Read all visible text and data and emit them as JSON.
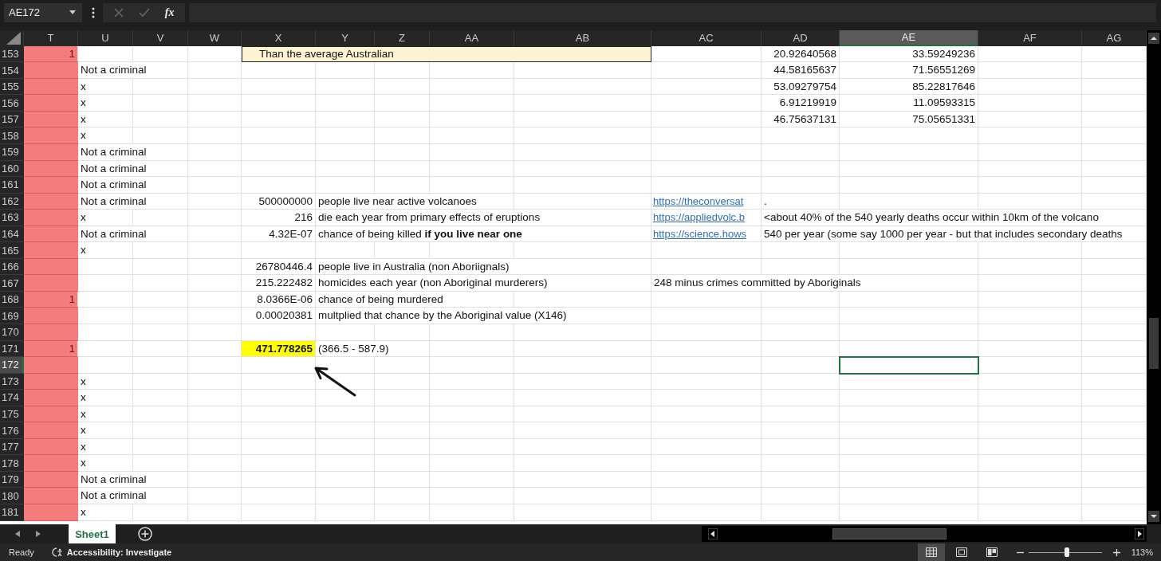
{
  "formula_bar": {
    "name_box": "AE172",
    "function_label": "fx",
    "edit_buttons_disabled": true
  },
  "columns": [
    {
      "label": "T",
      "selected": false
    },
    {
      "label": "U",
      "selected": false
    },
    {
      "label": "V",
      "selected": false
    },
    {
      "label": "W",
      "selected": false
    },
    {
      "label": "X",
      "selected": false
    },
    {
      "label": "Y",
      "selected": false
    },
    {
      "label": "Z",
      "selected": false
    },
    {
      "label": "AA",
      "selected": false
    },
    {
      "label": "AB",
      "selected": false
    },
    {
      "label": "AC",
      "selected": false
    },
    {
      "label": "AD",
      "selected": false
    },
    {
      "label": "AE",
      "selected": true
    },
    {
      "label": "AF",
      "selected": false
    },
    {
      "label": "AG",
      "selected": false
    }
  ],
  "rows": [
    {
      "label": "153",
      "selected": false,
      "flagged": true,
      "cells": [
        {
          "kind": "number",
          "text": "1"
        },
        null,
        null,
        null,
        {
          "kind": "note",
          "text": "Than the average Australian"
        },
        {
          "kind": "merged"
        },
        {
          "kind": "merged"
        },
        {
          "kind": "merged"
        },
        {
          "kind": "merged"
        },
        null,
        {
          "kind": "number",
          "text": "20.92640568"
        },
        {
          "kind": "number",
          "text": "33.59249236"
        },
        null,
        null
      ]
    },
    {
      "label": "154",
      "selected": false,
      "flagged": true,
      "cells": [
        null,
        {
          "kind": "text",
          "text": "Not a criminal"
        },
        null,
        null,
        null,
        null,
        null,
        null,
        null,
        null,
        {
          "kind": "number",
          "text": "44.58165637"
        },
        {
          "kind": "number",
          "text": "71.56551269"
        },
        null,
        null
      ]
    },
    {
      "label": "155",
      "selected": false,
      "flagged": true,
      "cells": [
        null,
        {
          "kind": "text",
          "text": "x"
        },
        null,
        null,
        null,
        null,
        null,
        null,
        null,
        null,
        {
          "kind": "number",
          "text": "53.09279754"
        },
        {
          "kind": "number",
          "text": "85.22817646"
        },
        null,
        null
      ]
    },
    {
      "label": "156",
      "selected": false,
      "flagged": true,
      "cells": [
        null,
        {
          "kind": "text",
          "text": "x"
        },
        null,
        null,
        null,
        null,
        null,
        null,
        null,
        null,
        {
          "kind": "number",
          "text": "6.91219919"
        },
        {
          "kind": "number",
          "text": "11.09593315"
        },
        null,
        null
      ]
    },
    {
      "label": "157",
      "selected": false,
      "flagged": true,
      "cells": [
        null,
        {
          "kind": "text",
          "text": "x"
        },
        null,
        null,
        null,
        null,
        null,
        null,
        null,
        null,
        {
          "kind": "number",
          "text": "46.75637131"
        },
        {
          "kind": "number",
          "text": "75.05651331"
        },
        null,
        null
      ]
    },
    {
      "label": "158",
      "selected": false,
      "flagged": true,
      "cells": [
        null,
        {
          "kind": "text",
          "text": "x"
        },
        null,
        null,
        null,
        null,
        null,
        null,
        null,
        null,
        null,
        null,
        null,
        null
      ]
    },
    {
      "label": "159",
      "selected": false,
      "flagged": true,
      "cells": [
        null,
        {
          "kind": "text",
          "text": "Not a criminal"
        },
        null,
        null,
        null,
        null,
        null,
        null,
        null,
        null,
        null,
        null,
        null,
        null
      ]
    },
    {
      "label": "160",
      "selected": false,
      "flagged": true,
      "cells": [
        null,
        {
          "kind": "text",
          "text": "Not a criminal"
        },
        null,
        null,
        null,
        null,
        null,
        null,
        null,
        null,
        null,
        null,
        null,
        null
      ]
    },
    {
      "label": "161",
      "selected": false,
      "flagged": true,
      "cells": [
        null,
        {
          "kind": "text",
          "text": "Not a criminal"
        },
        null,
        null,
        null,
        null,
        null,
        null,
        null,
        null,
        null,
        null,
        null,
        null
      ]
    },
    {
      "label": "162",
      "selected": false,
      "flagged": true,
      "cells": [
        null,
        {
          "kind": "text",
          "text": "Not a criminal"
        },
        null,
        null,
        {
          "kind": "number",
          "text": "500000000"
        },
        {
          "kind": "text",
          "text": "people live near active volcanoes"
        },
        null,
        null,
        null,
        {
          "kind": "link",
          "text": "https://theconversat"
        },
        {
          "kind": "text",
          "text": "."
        },
        null,
        null,
        null
      ]
    },
    {
      "label": "163",
      "selected": false,
      "flagged": true,
      "cells": [
        null,
        {
          "kind": "text",
          "text": "x"
        },
        null,
        null,
        {
          "kind": "number",
          "text": "216"
        },
        {
          "kind": "text",
          "text": "die each year from primary effects of eruptions"
        },
        null,
        null,
        null,
        {
          "kind": "link",
          "text": "https://appliedvolc.b"
        },
        {
          "kind": "text",
          "text": "<about 40% of the 540 yearly deaths occur within 10km of the volcano"
        },
        null,
        null,
        null
      ]
    },
    {
      "label": "164",
      "selected": false,
      "flagged": true,
      "cells": [
        null,
        {
          "kind": "text",
          "text": "Not a criminal"
        },
        null,
        null,
        {
          "kind": "number",
          "text": "4.32E-07"
        },
        {
          "kind": "text",
          "text": "chance of being killed **if you live near one**"
        },
        null,
        null,
        null,
        {
          "kind": "link",
          "text": "https://science.hows"
        },
        {
          "kind": "text",
          "text": "540 per year (some say 1000 per year - but that includes secondary deaths"
        },
        null,
        null,
        null
      ]
    },
    {
      "label": "165",
      "selected": false,
      "flagged": true,
      "cells": [
        null,
        {
          "kind": "text",
          "text": "x"
        },
        null,
        null,
        null,
        null,
        null,
        null,
        null,
        null,
        null,
        null,
        null,
        null
      ]
    },
    {
      "label": "166",
      "selected": false,
      "flagged": true,
      "cells": [
        null,
        null,
        null,
        null,
        {
          "kind": "number",
          "text": "26780446.4"
        },
        {
          "kind": "text",
          "text": "people live in Australia (non Aboriignals)"
        },
        null,
        null,
        null,
        null,
        null,
        null,
        null,
        null
      ]
    },
    {
      "label": "167",
      "selected": false,
      "flagged": true,
      "cells": [
        null,
        null,
        null,
        null,
        {
          "kind": "number",
          "text": "215.222482"
        },
        {
          "kind": "text",
          "text": "homicides each year (non Aboriginal murderers)"
        },
        null,
        null,
        null,
        {
          "kind": "text",
          "text": "248 minus crimes committed by Aboriginals"
        },
        null,
        null,
        null,
        null
      ]
    },
    {
      "label": "168",
      "selected": false,
      "flagged": true,
      "cells": [
        {
          "kind": "number",
          "text": "1"
        },
        null,
        null,
        null,
        {
          "kind": "number",
          "text": "8.0366E-06"
        },
        {
          "kind": "text",
          "text": "chance of being murdered"
        },
        null,
        null,
        null,
        null,
        null,
        null,
        null,
        null
      ]
    },
    {
      "label": "169",
      "selected": false,
      "flagged": true,
      "cells": [
        null,
        null,
        null,
        null,
        {
          "kind": "number",
          "text": "0.00020381"
        },
        {
          "kind": "text",
          "text": "multplied that chance by the Aboriginal value (X146)"
        },
        null,
        null,
        null,
        null,
        null,
        null,
        null,
        null
      ]
    },
    {
      "label": "170",
      "selected": false,
      "flagged": true,
      "cells": [
        null,
        null,
        null,
        null,
        null,
        null,
        null,
        null,
        null,
        null,
        null,
        null,
        null,
        null
      ]
    },
    {
      "label": "171",
      "selected": false,
      "flagged": true,
      "cells": [
        {
          "kind": "number",
          "text": "1"
        },
        null,
        null,
        null,
        {
          "kind": "number",
          "text": "471.778265",
          "highlighted": true,
          "bold": true
        },
        {
          "kind": "text",
          "text": "(366.5 - 587.9)"
        },
        null,
        null,
        null,
        null,
        null,
        null,
        null,
        null
      ]
    },
    {
      "label": "172",
      "selected": true,
      "flagged": true,
      "cells": [
        null,
        null,
        null,
        null,
        null,
        null,
        null,
        null,
        null,
        null,
        null,
        null,
        null,
        null
      ]
    },
    {
      "label": "173",
      "selected": false,
      "flagged": true,
      "cells": [
        null,
        {
          "kind": "text",
          "text": "x"
        },
        null,
        null,
        null,
        null,
        null,
        null,
        null,
        null,
        null,
        null,
        null,
        null
      ]
    },
    {
      "label": "174",
      "selected": false,
      "flagged": true,
      "cells": [
        null,
        {
          "kind": "text",
          "text": "x"
        },
        null,
        null,
        null,
        null,
        null,
        null,
        null,
        null,
        null,
        null,
        null,
        null
      ]
    },
    {
      "label": "175",
      "selected": false,
      "flagged": true,
      "cells": [
        null,
        {
          "kind": "text",
          "text": "x"
        },
        null,
        null,
        null,
        null,
        null,
        null,
        null,
        null,
        null,
        null,
        null,
        null
      ]
    },
    {
      "label": "176",
      "selected": false,
      "flagged": true,
      "cells": [
        null,
        {
          "kind": "text",
          "text": "x"
        },
        null,
        null,
        null,
        null,
        null,
        null,
        null,
        null,
        null,
        null,
        null,
        null
      ]
    },
    {
      "label": "177",
      "selected": false,
      "flagged": true,
      "cells": [
        null,
        {
          "kind": "text",
          "text": "x"
        },
        null,
        null,
        null,
        null,
        null,
        null,
        null,
        null,
        null,
        null,
        null,
        null
      ]
    },
    {
      "label": "178",
      "selected": false,
      "flagged": true,
      "cells": [
        null,
        {
          "kind": "text",
          "text": "x"
        },
        null,
        null,
        null,
        null,
        null,
        null,
        null,
        null,
        null,
        null,
        null,
        null
      ]
    },
    {
      "label": "179",
      "selected": false,
      "flagged": true,
      "cells": [
        null,
        {
          "kind": "text",
          "text": "Not a criminal"
        },
        null,
        null,
        null,
        null,
        null,
        null,
        null,
        null,
        null,
        null,
        null,
        null
      ]
    },
    {
      "label": "180",
      "selected": false,
      "flagged": true,
      "cells": [
        null,
        {
          "kind": "text",
          "text": "Not a criminal"
        },
        null,
        null,
        null,
        null,
        null,
        null,
        null,
        null,
        null,
        null,
        null,
        null
      ]
    },
    {
      "label": "181",
      "selected": false,
      "flagged": true,
      "cells": [
        null,
        {
          "kind": "text",
          "text": "x"
        },
        null,
        null,
        null,
        null,
        null,
        null,
        null,
        null,
        null,
        null,
        null,
        null
      ]
    }
  ],
  "sheet_tabs": [
    {
      "label": "Sheet1",
      "selected": true
    }
  ],
  "status_bar": {
    "mode": "Ready",
    "accessibility": "Accessibility: Investigate",
    "views": [
      {
        "kind": "normal",
        "selected": true
      },
      {
        "kind": "page-layout",
        "selected": false
      },
      {
        "kind": "page-break",
        "selected": false
      }
    ],
    "zoom": {
      "level": 0.52,
      "reading": "113%"
    }
  }
}
